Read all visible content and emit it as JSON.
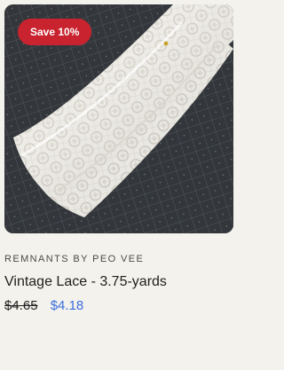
{
  "product": {
    "badge": "Save 10%",
    "vendor": "REMNANTS BY PEO VEE",
    "title": "Vintage Lace - 3.75-yards",
    "compare_price": "$4.65",
    "sale_price": "$4.18",
    "image": {
      "subject": "white lace bundle on grid cutting mat"
    }
  },
  "colors": {
    "badge_bg": "#c8232f",
    "sale_price": "#3d6de0",
    "background": "#f4f2ec"
  }
}
